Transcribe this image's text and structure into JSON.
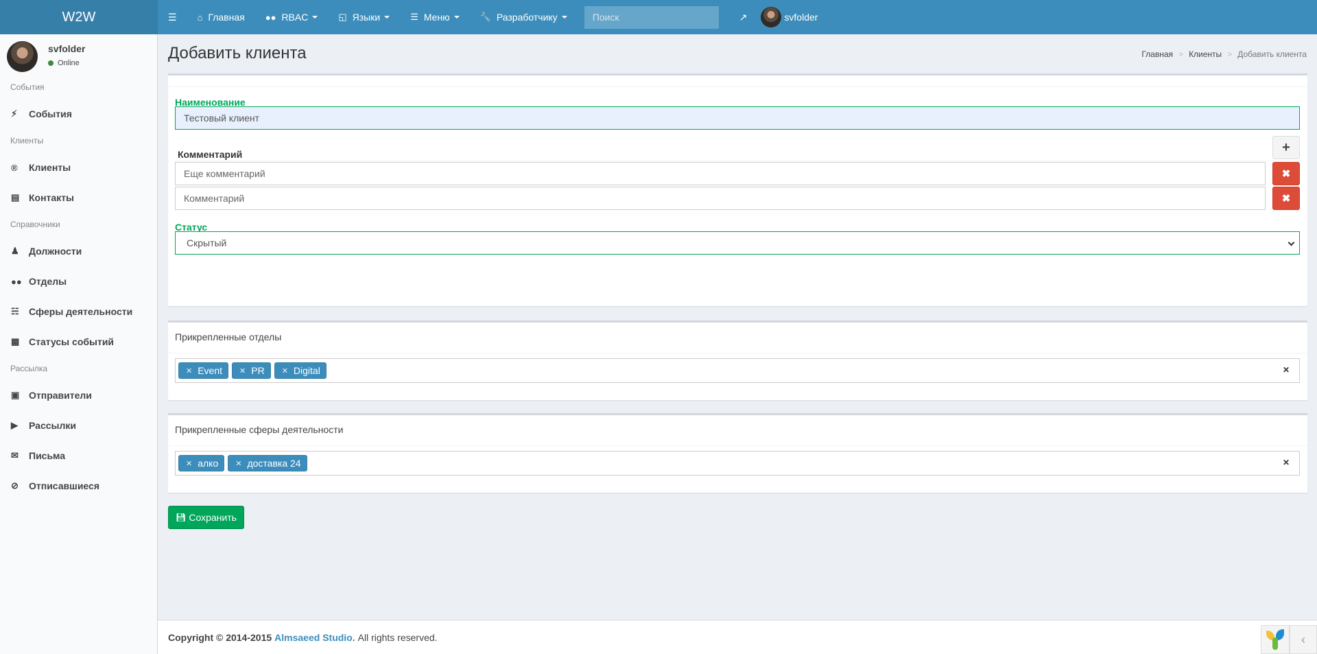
{
  "brand": "W2W",
  "topnav": {
    "items": [
      {
        "label": "Главная",
        "icon": "home-icon"
      },
      {
        "label": "RBAC",
        "icon": "users-icon"
      },
      {
        "label": "Языки",
        "icon": "language-icon"
      },
      {
        "label": "Меню",
        "icon": "list-icon"
      },
      {
        "label": "Разработчику",
        "icon": "wrench-icon"
      }
    ],
    "search_placeholder": "Поиск",
    "username": "svfolder"
  },
  "sidebar": {
    "user": {
      "name": "svfolder",
      "status": "Online"
    },
    "sections": [
      {
        "header": "События",
        "items": [
          {
            "label": "События",
            "icon": "bolt-icon"
          }
        ]
      },
      {
        "header": "Клиенты",
        "items": [
          {
            "label": "Клиенты",
            "icon": "registered-icon"
          },
          {
            "label": "Контакты",
            "icon": "address-card-icon"
          }
        ]
      },
      {
        "header": "Справочники",
        "items": [
          {
            "label": "Должности",
            "icon": "user-tie-icon"
          },
          {
            "label": "Отделы",
            "icon": "users-icon"
          },
          {
            "label": "Сферы деятельности",
            "icon": "sitemap-icon"
          },
          {
            "label": "Статусы событий",
            "icon": "clipboard-icon"
          }
        ]
      },
      {
        "header": "Рассылка",
        "items": [
          {
            "label": "Отправители",
            "icon": "address-book-icon"
          },
          {
            "label": "Рассылки",
            "icon": "bullhorn-icon"
          },
          {
            "label": "Письма",
            "icon": "envelope-icon"
          },
          {
            "label": "Отписавшиеся",
            "icon": "ban-icon"
          }
        ]
      }
    ]
  },
  "page": {
    "title": "Добавить клиента",
    "breadcrumb": [
      "Главная",
      "Клиенты",
      "Добавить клиента"
    ]
  },
  "form": {
    "name_label": "Наименование",
    "name_value": "Тестовый клиент",
    "comment_label": "Комментарий",
    "comments": [
      {
        "value": "Еще комментарий"
      },
      {
        "placeholder": "Комментарий"
      }
    ],
    "status_label": "Статус",
    "status_value": "Скрытый",
    "departments_title": "Прикрепленные отделы",
    "departments": [
      "Event",
      "PR",
      "Digital"
    ],
    "spheres_title": "Прикрепленные сферы деятельности",
    "spheres": [
      "алко",
      "доставка 24"
    ],
    "save_label": "Сохранить"
  },
  "footer": {
    "copyright": "Copyright © 2014-2015",
    "company": "Almsaeed Studio.",
    "rights": "All rights reserved."
  },
  "colors": {
    "primary": "#3c8dbc",
    "success": "#00a65a",
    "danger": "#dd4b39"
  }
}
